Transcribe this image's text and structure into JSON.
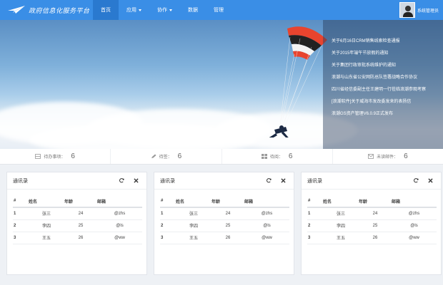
{
  "header": {
    "logo_text": "政府信息化服务平台",
    "nav": [
      {
        "label": "首页",
        "active": true,
        "dropdown": false
      },
      {
        "label": "应用",
        "active": false,
        "dropdown": true
      },
      {
        "label": "协作",
        "active": false,
        "dropdown": true
      },
      {
        "label": "数据",
        "active": false,
        "dropdown": false
      },
      {
        "label": "管理",
        "active": false,
        "dropdown": false
      }
    ],
    "user_name": "系统管理员"
  },
  "news": [
    "关于6月16日CRM销售线索检查通报",
    "关于2015年端午节放假的通知",
    "关于集团行政审批系统维护的通知",
    "浪潮与山东省公安网防总队签署战略合作协议",
    "四川省经信委副主任王建明一行莅临浪潮参观考察",
    "[浪潮软件]关于威海市发改委发来的表扬信",
    "浪潮GS资产管理V6.0.9正式发布"
  ],
  "stats": [
    {
      "icon": "inbox-icon",
      "label": "待办事项：",
      "value": "6"
    },
    {
      "icon": "pencil-icon",
      "label": "待签：",
      "value": "6"
    },
    {
      "icon": "grid-icon",
      "label": "待阅：",
      "value": "6"
    },
    {
      "icon": "mail-icon",
      "label": "未读邮件：",
      "value": "6"
    }
  ],
  "cards": [
    {
      "title": "通讯录",
      "columns": [
        "#",
        "姓名",
        "年龄",
        "邮箱"
      ],
      "rows": [
        [
          "1",
          "张三",
          "24",
          "@zhs"
        ],
        [
          "2",
          "李四",
          "25",
          "@ls"
        ],
        [
          "3",
          "王五",
          "26",
          "@ww"
        ]
      ]
    },
    {
      "title": "通讯录",
      "columns": [
        "#",
        "姓名",
        "年龄",
        "邮箱"
      ],
      "rows": [
        [
          "1",
          "张三",
          "24",
          "@zhs"
        ],
        [
          "2",
          "李四",
          "25",
          "@ls"
        ],
        [
          "3",
          "王五",
          "26",
          "@ww"
        ]
      ]
    },
    {
      "title": "通讯录",
      "columns": [
        "#",
        "姓名",
        "年龄",
        "邮箱"
      ],
      "rows": [
        [
          "1",
          "张三",
          "24",
          "@zhs"
        ],
        [
          "2",
          "李四",
          "25",
          "@ls"
        ],
        [
          "3",
          "王五",
          "26",
          "@ww"
        ]
      ]
    }
  ],
  "colors": {
    "header_bg": "#3a8ee6",
    "nav_active": "#2a79cf",
    "page_bg": "#eef1f5"
  }
}
